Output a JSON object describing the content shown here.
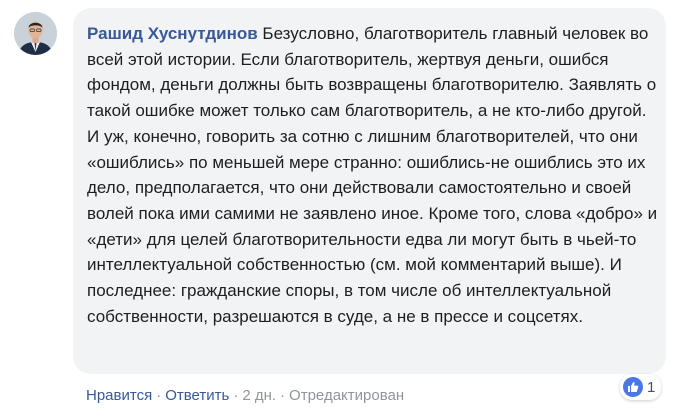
{
  "comment": {
    "author": "Рашид Хуснутдинов",
    "text": "Безусловно, благотворитель главный человек во всей этой истории. Если благотворитель, жертвуя деньги, ошибся фондом, деньги должны быть возвращены благотворителю. Заявлять о такой ошибке может только сам благотворитель, а не кто-либо другой. И уж, конечно, говорить за сотню с лишним благотворителей, что они «ошиблись» по меньшей мере странно: ошиблись-не ошиблись это их дело, предполагается, что они действовали самостоятельно и своей волей пока ими самими не заявлено иное. Кроме того, слова «добро» и «дети» для целей благотворительности едва ли могут быть в чьей-то интеллектуальной собственностью (см. мой комментарий выше). И последнее: гражданские споры, в том числе об интеллектуальной собственности, разрешаются в суде, а не в прессе и соцсетях."
  },
  "actions": {
    "like_label": "Нравится",
    "reply_label": "Ответить",
    "separator": "·",
    "time": "2 дн.",
    "edited": "Отредактирован"
  },
  "reactions": {
    "count": "1",
    "icon": "thumbs-up-icon",
    "color": "#4a76e8"
  },
  "colors": {
    "author": "#385898",
    "bubble": "#f2f3f5",
    "meta": "#90949c"
  }
}
